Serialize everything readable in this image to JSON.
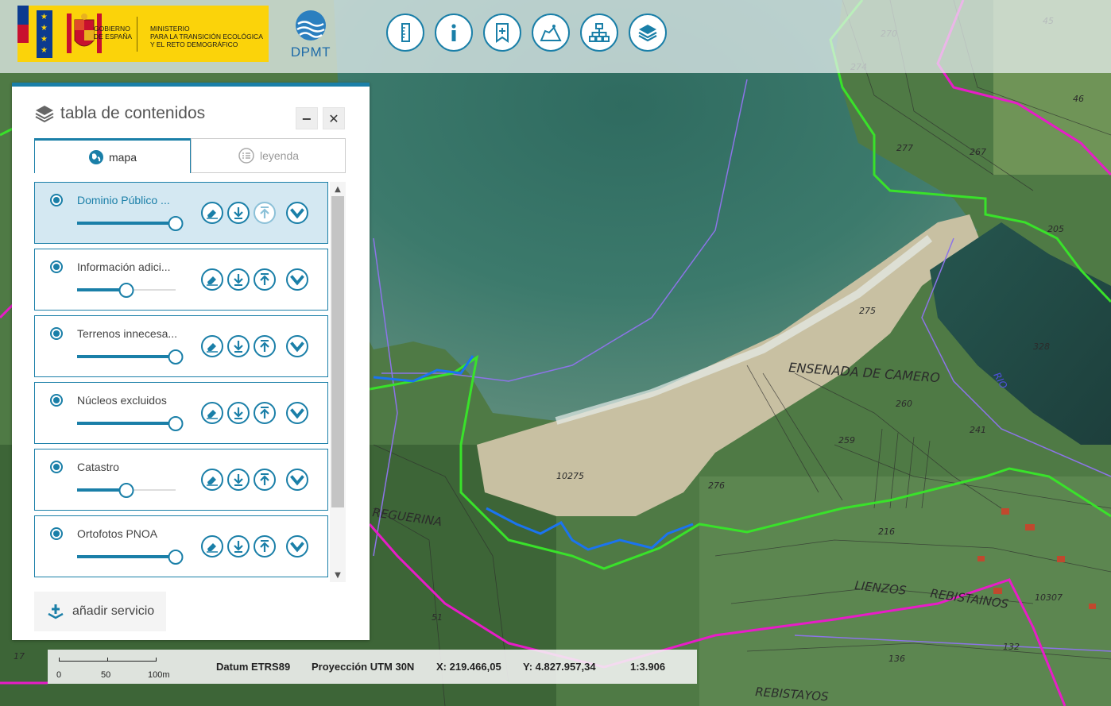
{
  "header": {
    "gobierno_lines": [
      "GOBIERNO",
      "DE ESPAÑA"
    ],
    "ministerio_lines": [
      "MINISTERIO",
      "PARA LA TRANSICIÓN ECOLÓGICA",
      "Y EL RETO DEMOGRÁFICO"
    ],
    "dpmt_label": "DPMT",
    "toolbar_icons": [
      "ruler-icon",
      "info-icon",
      "bookmark-add-icon",
      "map-measure-icon",
      "hierarchy-icon",
      "layers-icon"
    ]
  },
  "panel": {
    "title": "tabla de contenidos",
    "minimize_label": "−",
    "close_label": "✕",
    "tabs": [
      {
        "label": "mapa",
        "active": true
      },
      {
        "label": "leyenda",
        "active": false
      }
    ],
    "layers": [
      {
        "name": "Dominio Público ...",
        "opacity": 1.0,
        "active": true,
        "up_disabled": true
      },
      {
        "name": "Información adici...",
        "opacity": 0.5,
        "active": false,
        "up_disabled": false
      },
      {
        "name": "Terrenos innecesa...",
        "opacity": 1.0,
        "active": false,
        "up_disabled": false
      },
      {
        "name": "Núcleos excluidos",
        "opacity": 1.0,
        "active": false,
        "up_disabled": false
      },
      {
        "name": "Catastro",
        "opacity": 0.5,
        "active": false,
        "up_disabled": false
      },
      {
        "name": "Ortofotos PNOA",
        "opacity": 1.0,
        "active": false,
        "up_disabled": false
      }
    ],
    "add_service_label": "añadir servicio"
  },
  "statusbar": {
    "scale_labels": [
      "0",
      "50",
      "100m"
    ],
    "datum": "Datum ETRS89",
    "projection": "Proyección UTM 30N",
    "x": "X: 219.466,05",
    "y": "Y: 4.827.957,34",
    "scale": "1:3.906"
  },
  "map": {
    "labels": [
      "ENSENADA DE CAMERO",
      "RIO",
      "LIENZOS",
      "REBISTAINOS",
      "REBISTAYOS",
      "REGUERINA",
      "10275",
      "275",
      "276",
      "260",
      "259",
      "241",
      "328",
      "270",
      "274",
      "277",
      "267",
      "205",
      "216",
      "132",
      "136",
      "10307",
      "51",
      "46",
      "17",
      "45"
    ]
  }
}
